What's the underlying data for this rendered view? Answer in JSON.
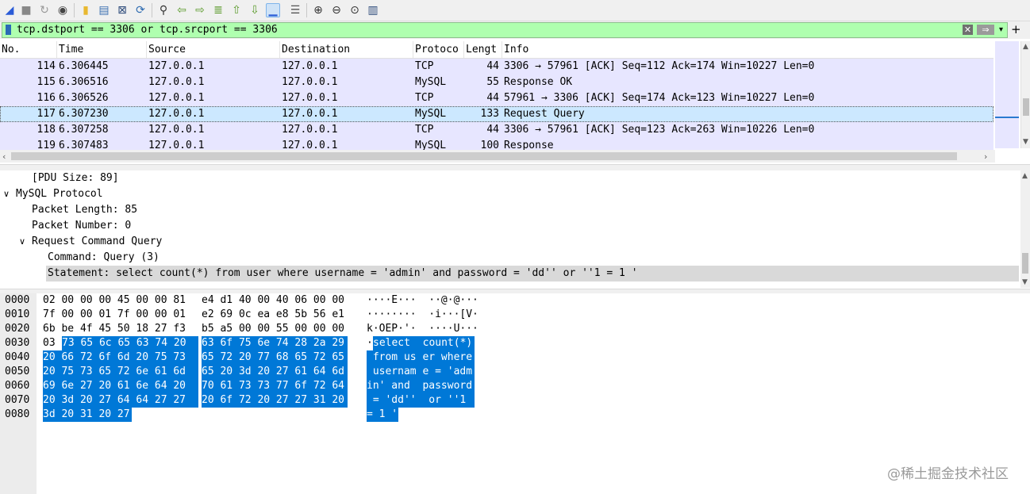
{
  "toolbar": {
    "icons": [
      "shark-fin-icon",
      "stop-icon",
      "restart-icon",
      "options-icon",
      "open-file-icon",
      "save-file-icon",
      "close-file-icon",
      "reload-file-icon",
      "find-icon",
      "go-back-icon",
      "go-forward-icon",
      "go-to-packet-icon",
      "go-first-icon",
      "go-last-icon",
      "autoscroll-icon",
      "colorize-icon",
      "zoom-in-icon",
      "zoom-out-icon",
      "zoom-normal-icon",
      "resize-columns-icon"
    ]
  },
  "filter": {
    "value": "tcp.dstport == 3306 or tcp.srcport == 3306",
    "clear_glyph": "✕",
    "apply_glyph": "⇒",
    "dropdown_glyph": "▾",
    "add_glyph": "+",
    "bg_color": "#afffaf"
  },
  "packet_list": {
    "columns": [
      "No.",
      "Time",
      "Source",
      "Destination",
      "Protoco",
      "Lengt",
      "Info"
    ],
    "rows": [
      {
        "no": "114",
        "time": "6.306445",
        "src": "127.0.0.1",
        "dst": "127.0.0.1",
        "proto": "TCP",
        "len": "44",
        "info": "3306 → 57961 [ACK] Seq=112 Ack=174 Win=10227 Len=0"
      },
      {
        "no": "115",
        "time": "6.306516",
        "src": "127.0.0.1",
        "dst": "127.0.0.1",
        "proto": "MySQL",
        "len": "55",
        "info": "Response OK"
      },
      {
        "no": "116",
        "time": "6.306526",
        "src": "127.0.0.1",
        "dst": "127.0.0.1",
        "proto": "TCP",
        "len": "44",
        "info": "57961 → 3306 [ACK] Seq=174 Ack=123 Win=10227 Len=0"
      },
      {
        "no": "117",
        "time": "6.307230",
        "src": "127.0.0.1",
        "dst": "127.0.0.1",
        "proto": "MySQL",
        "len": "133",
        "info": "Request Query"
      },
      {
        "no": "118",
        "time": "6.307258",
        "src": "127.0.0.1",
        "dst": "127.0.0.1",
        "proto": "TCP",
        "len": "44",
        "info": "3306 → 57961 [ACK] Seq=123 Ack=263 Win=10226 Len=0"
      },
      {
        "no": "119",
        "time": "6.307483",
        "src": "127.0.0.1",
        "dst": "127.0.0.1",
        "proto": "MySQL",
        "len": "100",
        "info": "Response"
      }
    ],
    "selected_no": "117",
    "row_color": "#e7e6ff",
    "selected_color": "#cce8ff"
  },
  "details": {
    "pdu_size": "[PDU Size: 89]",
    "protocol_label": "MySQL Protocol",
    "packet_length": "Packet Length: 85",
    "packet_number": "Packet Number: 0",
    "request_label": "Request Command Query",
    "command": "Command: Query (3)",
    "statement": "Statement: select count(*) from user where username = 'admin' and password = 'dd'' or ''1 = 1 '",
    "expanded_glyph": "∨",
    "expanded_glyph2": "∨"
  },
  "bytes": {
    "offsets": [
      "0000",
      "0010",
      "0020",
      "0030",
      "0040",
      "0050",
      "0060",
      "0070",
      "0080"
    ],
    "lines": [
      {
        "hex_a": "02 00 00 00 45 00 00 81",
        "hex_b": "e4 d1 40 00 40 06 00 00",
        "ascii": "····E···  ··@·@···"
      },
      {
        "hex_a": "7f 00 00 01 7f 00 00 01",
        "hex_b": "e2 69 0c ea e8 5b 56 e1",
        "ascii": "········  ·i···[V·"
      },
      {
        "hex_a": "6b be 4f 45 50 18 27 f3",
        "hex_b": "b5 a5 00 00 55 00 00 00",
        "ascii": "k·OEP·'·  ····U···"
      },
      {
        "plain": "03",
        "hex_a": "73 65 6c 65 63 74 20",
        "hex_b": "63 6f 75 6e 74 28 2a 29",
        "ascii_plain": "·",
        "ascii": "select  count(*)"
      },
      {
        "hex_a": "20 66 72 6f 6d 20 75 73",
        "hex_b": "65 72 20 77 68 65 72 65",
        "ascii": " from us er where"
      },
      {
        "hex_a": "20 75 73 65 72 6e 61 6d",
        "hex_b": "65 20 3d 20 27 61 64 6d",
        "ascii": " usernam e = 'adm"
      },
      {
        "hex_a": "69 6e 27 20 61 6e 64 20",
        "hex_b": "70 61 73 73 77 6f 72 64",
        "ascii": "in' and  password"
      },
      {
        "hex_a": "20 3d 20 27 64 64 27 27",
        "hex_b": "20 6f 72 20 27 27 31 20",
        "ascii": " = 'dd''  or ''1 "
      },
      {
        "hex_a": "3d 20 31 20 27",
        "hex_b": "",
        "ascii": "= 1 '"
      }
    ],
    "highlight_color": "#0078d7"
  },
  "watermark": "@稀土掘金技术社区"
}
